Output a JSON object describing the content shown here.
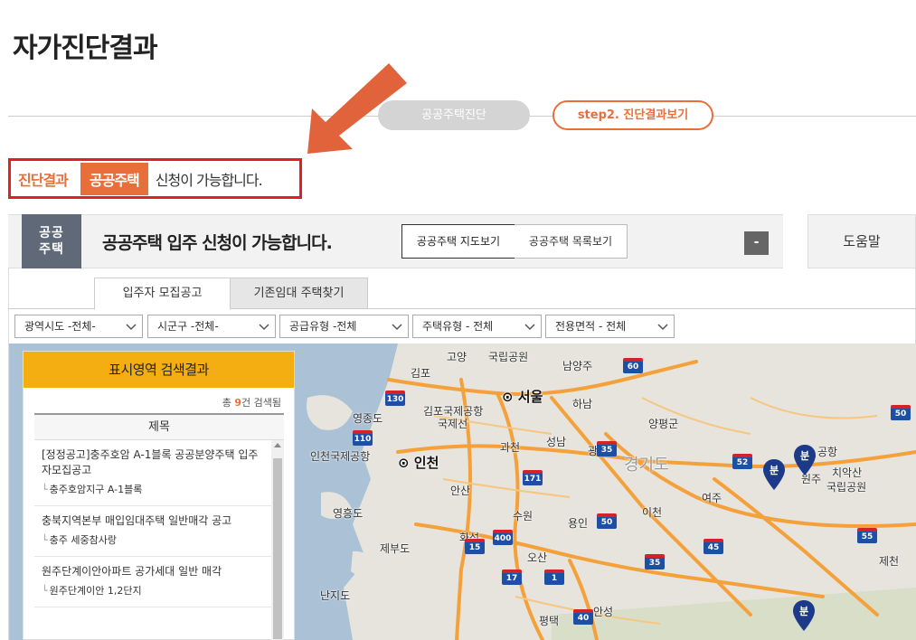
{
  "page": {
    "title": "자가진단결과"
  },
  "steps": {
    "step1": "공공주택진단",
    "step2": "step2. 진단결과보기"
  },
  "result": {
    "label": "진단결과",
    "badge": "공공주택",
    "text": "신청이 가능합니다."
  },
  "panel": {
    "ribbon": "공공\n주택",
    "title": "공공주택 입주 신청이 가능합니다.",
    "map_button": "공공주택 지도보기",
    "list_button": "공공주택 목록보기",
    "collapse_button": "-",
    "help": "도움말"
  },
  "tabs": {
    "active": "입주자 모집공고",
    "inactive": "기존임대 주택찾기"
  },
  "filters": [
    "광역시도 -전체-",
    "시군구 -전체-",
    "공급유형 -전체",
    "주택유형 - 전체",
    "전용면적 - 전체"
  ],
  "results": {
    "title": "표시영역 검색결과",
    "count_prefix": "총 ",
    "count": "9",
    "count_suffix": "건 검색됨",
    "column": "제목",
    "items": [
      {
        "title": "[정정공고]충주호암 A-1블록 공공분양주택 입주자모집공고",
        "sub": "충주호암지구 A-1블록"
      },
      {
        "title": "충북지역본부 매입임대주택 일반매각 공고",
        "sub": "충주 세중참사랑"
      },
      {
        "title": "원주단계이안아파트 공가세대 일반 매각",
        "sub": "원주단계이안 1,2단지"
      }
    ]
  },
  "map": {
    "labels": {
      "goyang": "고양",
      "national_park": "국립공원",
      "namyangju": "남양주",
      "gimpo": "김포",
      "seoul": "서울",
      "hanam": "하남",
      "yeongjongdo": "영종도",
      "gimpo_airport": "김포국제공항",
      "gimpo_airport2": "국제선",
      "yangpyeong": "양평군",
      "incheon_airport": "인천국제공항",
      "incheon": "인천",
      "gwacheon": "과천",
      "seongnam": "성남",
      "gwang": "광",
      "gyeonggido": "경기도",
      "wonju": "원주",
      "chiaksan": "치악산",
      "chiaksan2": "국립공원",
      "ansan": "안산",
      "yeoju": "여주",
      "yeongheungdo": "영흥도",
      "suwon": "수원",
      "yongin": "용인",
      "icheon": "이천",
      "hwaseong": "화성",
      "jebudo": "제부도",
      "osan": "오산",
      "jecheon": "제천",
      "nanjido": "난지도",
      "pyeongtaek": "평택",
      "anseong": "안성",
      "airport": "공항"
    },
    "highways": [
      "130",
      "110",
      "60",
      "35",
      "52",
      "50",
      "171",
      "400",
      "15",
      "50",
      "55",
      "45",
      "35",
      "17",
      "1",
      "40"
    ],
    "pin_label": "분"
  },
  "colors": {
    "accent": "#e86f3a",
    "highlight_border": "#e21e26",
    "ribbon": "#5f6977",
    "results_header": "#f5ae11",
    "sea": "#aac1d6",
    "land": "#e6e4dc",
    "road": "#f4a13c"
  }
}
